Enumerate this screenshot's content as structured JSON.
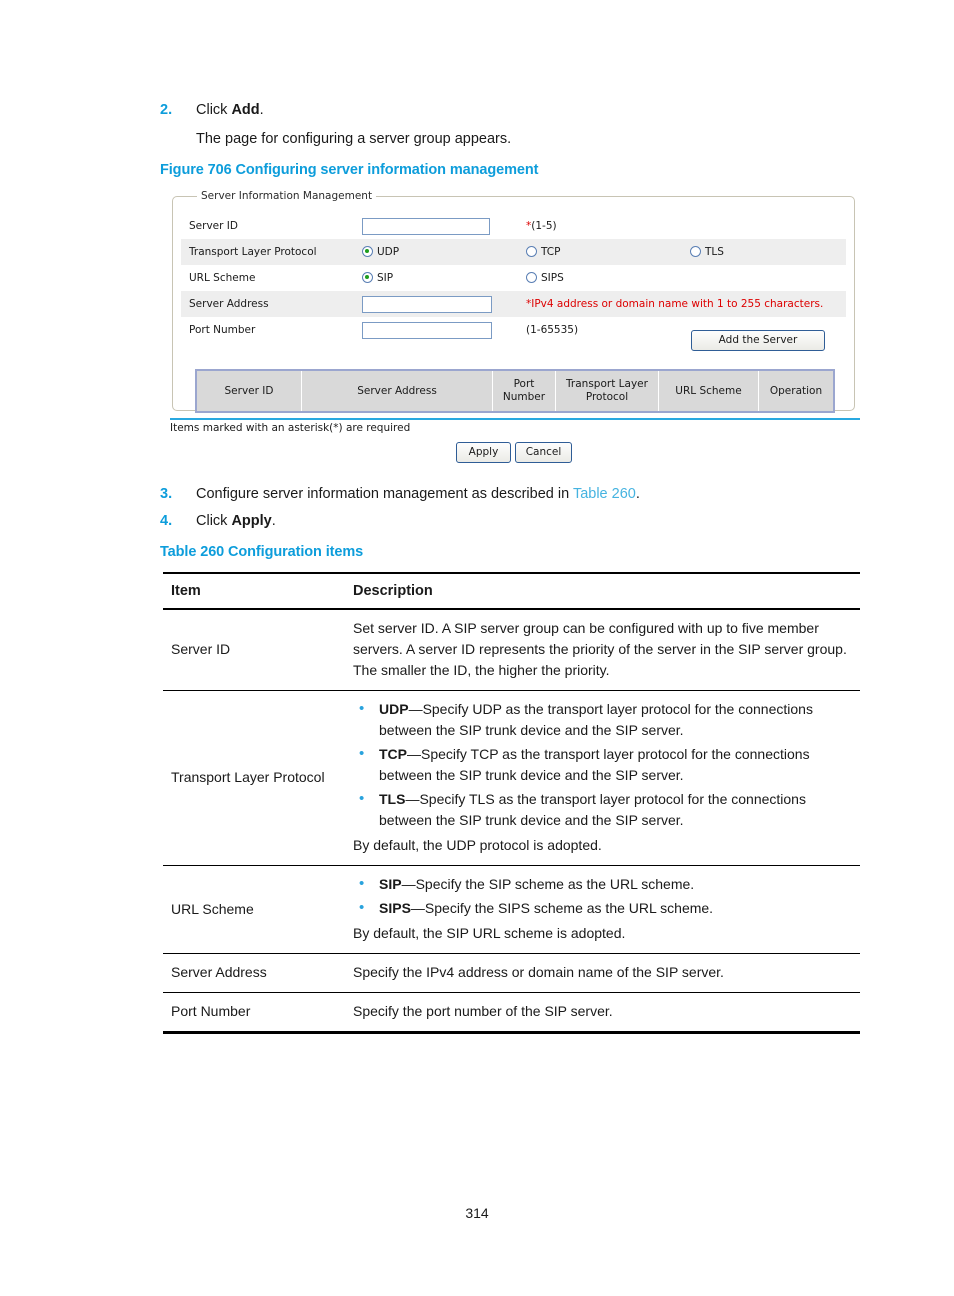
{
  "steps": [
    {
      "num": "2.",
      "pre": "Click ",
      "bold": "Add",
      "post": "."
    },
    {
      "num": "3.",
      "pre": "Configure server information management as described in ",
      "xref": "Table 260",
      "post": "."
    },
    {
      "num": "4.",
      "pre": "Click ",
      "bold": "Apply",
      "post": "."
    }
  ],
  "step2_sub": "The page for configuring a server group appears.",
  "figure_caption": "Figure 706 Configuring server information management",
  "table_caption": "Table 260 Configuration items",
  "screenshot": {
    "legend": "Server Information Management",
    "rows": {
      "server_id_label": "Server ID",
      "server_id_hint_star": "*",
      "server_id_hint": "(1-5)",
      "transport_label": "Transport Layer Protocol",
      "transport_options": [
        "UDP",
        "TCP",
        "TLS"
      ],
      "transport_selected": "UDP",
      "url_label": "URL Scheme",
      "url_options": [
        "SIP",
        "SIPS"
      ],
      "url_selected": "SIP",
      "server_address_label": "Server Address",
      "server_address_hint_star": "*",
      "server_address_hint": "IPv4 address or domain name with 1 to 255 characters.",
      "port_label": "Port Number",
      "port_hint": "(1-65535)"
    },
    "inputs": {
      "server_id_value": "",
      "server_id_placeholder": "",
      "server_address_value": "",
      "server_address_placeholder": "",
      "port_value": "",
      "port_placeholder": ""
    },
    "add_server_button": "Add the Server",
    "grid_headers": [
      "Server ID",
      "Server Address",
      "Port\nNumber",
      "Transport Layer\nProtocol",
      "URL Scheme",
      "Operation"
    ],
    "grid_headers_flat": {
      "server_id": "Server ID",
      "server_address": "Server Address",
      "port_number_l1": "Port",
      "port_number_l2": "Number",
      "transport_l1": "Transport Layer",
      "transport_l2": "Protocol",
      "url_scheme": "URL Scheme",
      "operation": "Operation"
    },
    "asterisk_note": "Items marked with an asterisk(*) are required",
    "apply_button": "Apply",
    "cancel_button": "Cancel"
  },
  "config_table": {
    "headers": {
      "item": "Item",
      "description": "Description"
    },
    "server_id": {
      "item": "Server ID",
      "description": "Set server ID. A SIP server group can be configured with up to five member servers. A server ID represents the priority of the server in the SIP server group. The smaller the ID, the higher the priority."
    },
    "transport": {
      "item": "Transport Layer Protocol",
      "bullets": [
        {
          "term": "UDP",
          "text": "—Specify UDP as the transport layer protocol for the connections between the SIP trunk device and the SIP server."
        },
        {
          "term": "TCP",
          "text": "—Specify TCP as the transport layer protocol for the connections between the SIP trunk device and the SIP server."
        },
        {
          "term": "TLS",
          "text": "—Specify TLS as the transport layer protocol for the connections between the SIP trunk device and the SIP server."
        }
      ],
      "tail": "By default, the UDP protocol is adopted."
    },
    "url_scheme": {
      "item": "URL Scheme",
      "bullets": [
        {
          "term": "SIP",
          "text": "—Specify the SIP scheme as the URL scheme."
        },
        {
          "term": "SIPS",
          "text": "—Specify the SIPS scheme as the URL scheme."
        }
      ],
      "tail": "By default, the SIP URL scheme is adopted."
    },
    "server_address": {
      "item": "Server Address",
      "description": "Specify the IPv4 address or domain name of the SIP server."
    },
    "port_number": {
      "item": "Port Number",
      "description": "Specify the port number of the SIP server."
    }
  },
  "page_number": "314",
  "colors": {
    "accent_blue": "#0d9ddb",
    "xref_blue": "#45b3e0",
    "bullet_blue": "#2aa3dd",
    "required_red": "#dd0000",
    "radio_green": "#1f9e1f"
  }
}
